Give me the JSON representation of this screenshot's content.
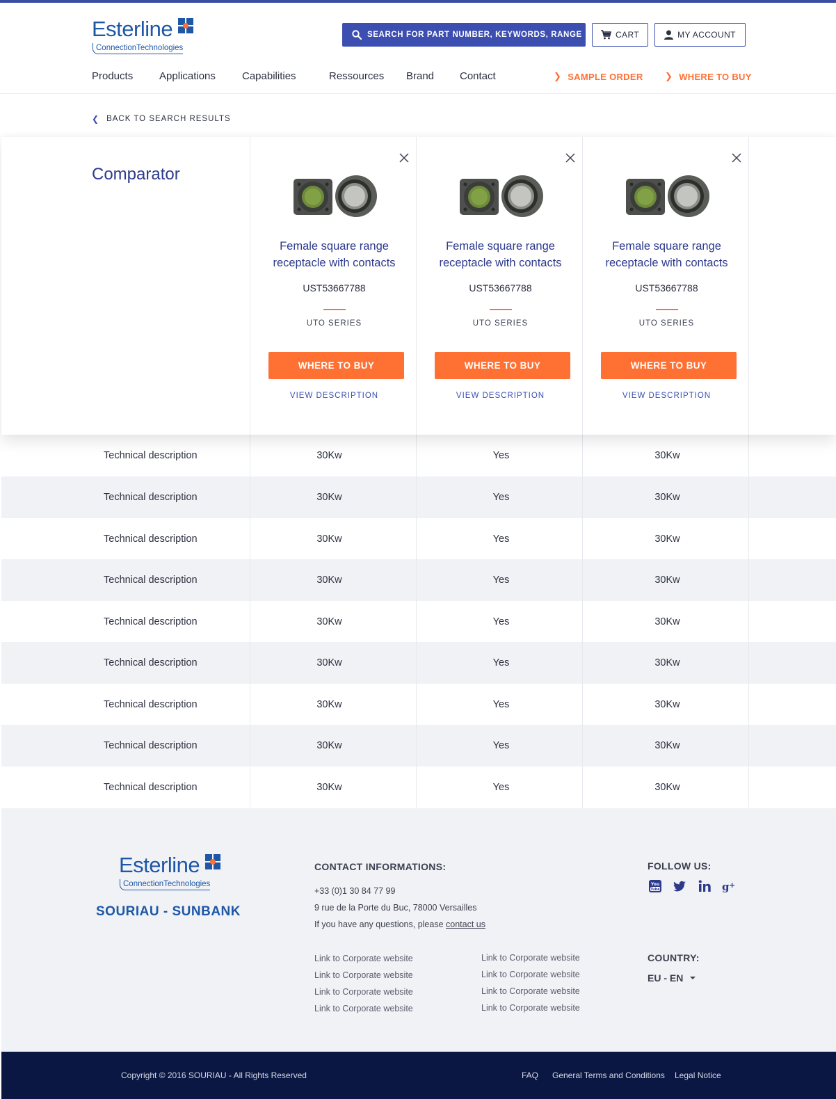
{
  "header": {
    "logo": {
      "word": "Esterline",
      "tagline": "ConnectionTechnologies"
    },
    "search_label": "SEARCH FOR PART NUMBER, KEYWORDS, RANGE",
    "cart_label": "CART",
    "account_label": "MY ACCOUNT",
    "nav": [
      "Products",
      "Applications",
      "Capabilities",
      "Ressources",
      "Brand",
      "Contact"
    ],
    "sample_order": "SAMPLE ORDER",
    "where_to_buy": "WHERE TO BUY"
  },
  "back_link": "BACK TO SEARCH RESULTS",
  "comparator": {
    "title": "Comparator",
    "products": [
      {
        "name_line1": "Female square range",
        "name_line2": "receptacle with contacts",
        "ref": "UST53667788",
        "series": "UTO SERIES",
        "buy_label": "WHERE TO BUY",
        "desc_label": "VIEW DESCRIPTION"
      },
      {
        "name_line1": "Female square range",
        "name_line2": "receptacle with contacts",
        "ref": "UST53667788",
        "series": "UTO SERIES",
        "buy_label": "WHERE TO BUY",
        "desc_label": "VIEW DESCRIPTION"
      },
      {
        "name_line1": "Female square range",
        "name_line2": "receptacle with contacts",
        "ref": "UST53667788",
        "series": "UTO SERIES",
        "buy_label": "WHERE TO BUY",
        "desc_label": "VIEW DESCRIPTION"
      }
    ]
  },
  "table": {
    "rows": [
      {
        "label": "Technical description",
        "values": [
          "30Kw",
          "Yes",
          "30Kw"
        ]
      },
      {
        "label": "Technical description",
        "values": [
          "30Kw",
          "Yes",
          "30Kw"
        ]
      },
      {
        "label": "Technical description",
        "values": [
          "30Kw",
          "Yes",
          "30Kw"
        ]
      },
      {
        "label": "Technical description",
        "values": [
          "30Kw",
          "Yes",
          "30Kw"
        ]
      },
      {
        "label": "Technical description",
        "values": [
          "30Kw",
          "Yes",
          "30Kw"
        ]
      },
      {
        "label": "Technical description",
        "values": [
          "30Kw",
          "Yes",
          "30Kw"
        ]
      },
      {
        "label": "Technical description",
        "values": [
          "30Kw",
          "Yes",
          "30Kw"
        ]
      },
      {
        "label": "Technical description",
        "values": [
          "30Kw",
          "Yes",
          "30Kw"
        ]
      },
      {
        "label": "Technical description",
        "values": [
          "30Kw",
          "Yes",
          "30Kw"
        ]
      }
    ]
  },
  "footer": {
    "logo": {
      "word": "Esterline",
      "tagline": "ConnectionTechnologies"
    },
    "brand_line": "SOURIAU - SUNBANK",
    "contact_heading": "CONTACT INFORMATIONS:",
    "phone": "+33 (0)1 30 84 77 99",
    "address": "9 rue de la Porte du Buc, 78000 Versailles",
    "question_prefix": "If you have any questions, please ",
    "contact_link": "contact us",
    "links_col1": [
      "Link to Corporate website",
      "Link to Corporate website",
      "Link to Corporate website",
      "Link to Corporate website"
    ],
    "links_col2": [
      "Link to Corporate website",
      "Link to Corporate website",
      "Link to Corporate website",
      "Link to Corporate website"
    ],
    "follow_heading": "FOLLOW US:",
    "social_icons": [
      "youtube-icon",
      "twitter-icon",
      "linkedin-icon",
      "google-plus-icon"
    ],
    "country_heading": "COUNTRY:",
    "country_value": "EU - EN"
  },
  "bottom": {
    "copyright": "Copyright © 2016 SOURIAU - All Rights Reserved",
    "faq": "FAQ",
    "terms": "General Terms and Conditions",
    "legal": "Legal Notice"
  },
  "colors": {
    "primary": "#3c4eb0",
    "accent": "#ff7033",
    "navy": "#0a1743",
    "title_blue": "#2d3a8c",
    "logo_blue": "#1d57a6"
  }
}
